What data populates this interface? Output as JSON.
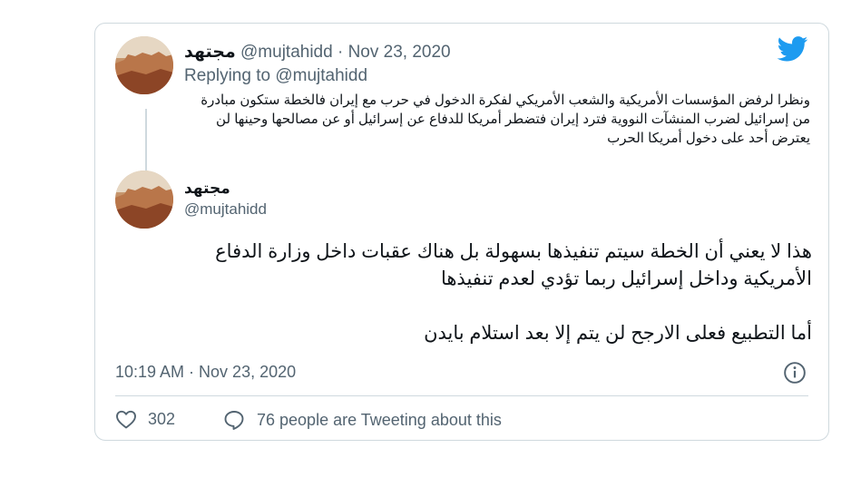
{
  "quoted_tweet": {
    "display_name": "مجتهد",
    "handle": "@mujtahidd",
    "separator": "·",
    "date": "Nov 23, 2020",
    "replying_prefix": "Replying to",
    "replying_handle": "@mujtahidd",
    "text": "ونظرا لرفض المؤسسات الأمريكية والشعب الأمريكي لفكرة الدخول في حرب مع إيران فالخطة ستكون مبادرة من إسرائيل لضرب المنشآت النووية فترد إيران فتضطر أمريكا للدفاع عن إسرائيل أو عن مصالحها وحينها لن يعترض أحد على دخول أمريكا الحرب"
  },
  "main_tweet": {
    "display_name": "مجتهد",
    "handle": "@mujtahidd",
    "paragraphs": [
      "هذا لا يعني أن الخطة سيتم تنفيذها بسهولة بل هناك عقبات داخل وزارة الدفاع الأمريكية وداخل إسرائيل ربما تؤدي لعدم تنفيذها",
      "أما التطبيع فعلى الارجح لن يتم إلا بعد استلام بايدن"
    ],
    "timestamp": "10:19 AM · Nov 23, 2020"
  },
  "actions": {
    "like_count": "302",
    "tweeting_text": "76 people are Tweeting about this"
  },
  "colors": {
    "brand_blue": "#1d9bf0",
    "secondary_text": "#536471",
    "border": "#cfd9de"
  },
  "icons": {
    "brand": "twitter-bird-icon",
    "info": "info-icon",
    "like": "heart-icon",
    "reply": "speech-bubble-icon"
  }
}
